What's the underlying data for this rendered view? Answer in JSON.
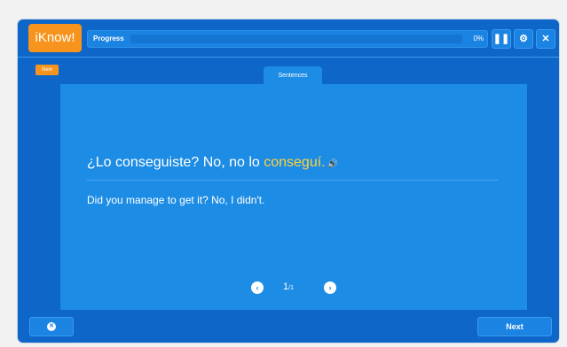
{
  "brand": {
    "logo_text": "iKnow!"
  },
  "progress": {
    "label": "Progress",
    "value_text": "0%",
    "value": 0
  },
  "toolbar": {
    "pause_icon": "pause-icon",
    "settings_icon": "gear-icon",
    "close_icon": "close-icon"
  },
  "badge": {
    "new_label": "New"
  },
  "tabs": {
    "sentences_label": "Sentences"
  },
  "sentence": {
    "prefix": "¿Lo conseguiste? No, no lo ",
    "highlight": "conseguí.",
    "speaker_icon": "speaker-icon"
  },
  "translation": {
    "text": "Did you manage to get it? No, I didn't."
  },
  "pager": {
    "current": "1",
    "total": "/1"
  },
  "footer": {
    "next_label": "Next"
  },
  "colors": {
    "accent_orange": "#f7941d",
    "bg_blue": "#0e66c8",
    "card_blue": "#1d8ce4",
    "highlight_yellow": "#ffd33d"
  }
}
